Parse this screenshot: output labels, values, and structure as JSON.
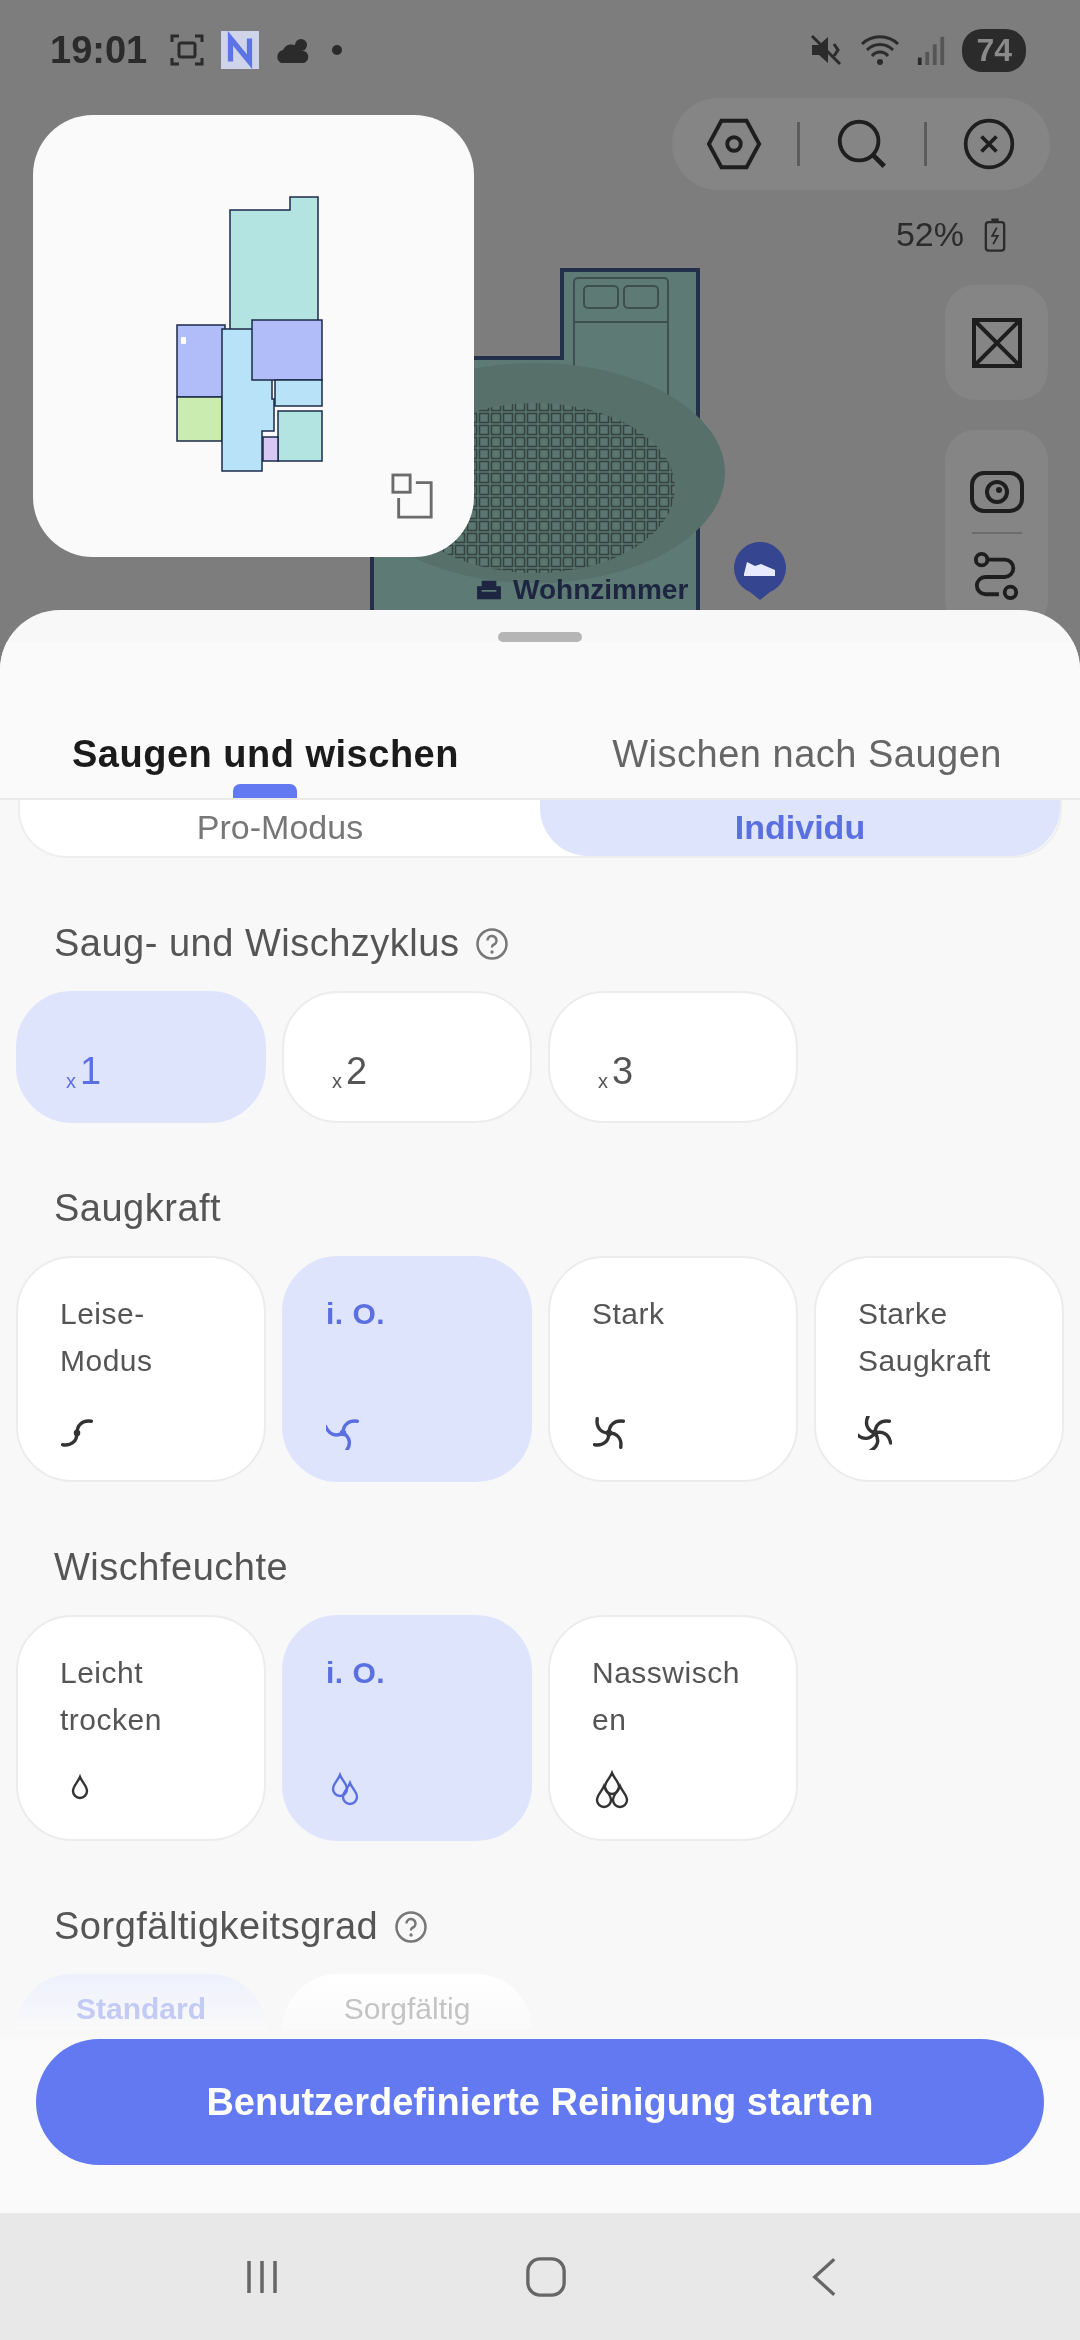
{
  "status_bar": {
    "time": "19:01",
    "battery": "74"
  },
  "map": {
    "battery_percent": "52%",
    "room_label": "Wohnzimmer"
  },
  "sheet": {
    "tabs": [
      {
        "label": "Saugen und wischen",
        "selected": true
      },
      {
        "label": "Wischen nach Saugen",
        "selected": false
      }
    ],
    "mode_toggle": [
      {
        "label": "Pro-Modus",
        "selected": false
      },
      {
        "label": "Individu",
        "selected": true
      }
    ],
    "sections": [
      {
        "title": "Saug- und Wischzyklus",
        "help": true,
        "kind": "cycle",
        "options": [
          {
            "label": "$_{x}$1",
            "selected": true
          },
          {
            "label": "$_{x}$2",
            "selected": false
          },
          {
            "label": "$_{x}$3",
            "selected": false
          }
        ]
      },
      {
        "title": "Saugkraft",
        "help": false,
        "kind": "suction",
        "options": [
          {
            "label": "Leise-Modus",
            "selected": false
          },
          {
            "label": "i. O.",
            "selected": true
          },
          {
            "label": "Stark",
            "selected": false
          },
          {
            "label": "Starke Saugkraft",
            "selected": false
          }
        ]
      },
      {
        "title": "Wischfeuchte",
        "help": false,
        "kind": "moisture",
        "options": [
          {
            "label": "Leicht trocken",
            "selected": false
          },
          {
            "label": "i. O.",
            "selected": true
          },
          {
            "label": "Nasswischen",
            "selected": false
          }
        ]
      },
      {
        "title": "Sorgfältigkeitsgrad",
        "help": true,
        "kind": "plain",
        "options": [
          {
            "label": "Standard",
            "selected": true
          },
          {
            "label": "Sorgfältig",
            "selected": false
          }
        ]
      }
    ],
    "start_button": "Benutzerdefinierte Reinigung starten"
  }
}
